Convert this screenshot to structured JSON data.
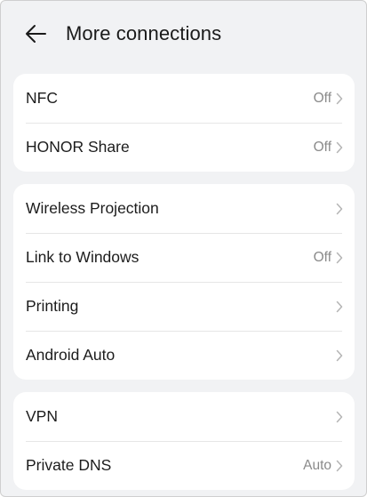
{
  "header": {
    "back_icon": "arrow-left-icon",
    "title": "More connections"
  },
  "groups": [
    {
      "items": [
        {
          "label": "NFC",
          "value": "Off"
        },
        {
          "label": "HONOR Share",
          "value": "Off"
        }
      ]
    },
    {
      "items": [
        {
          "label": "Wireless Projection",
          "value": ""
        },
        {
          "label": "Link to Windows",
          "value": "Off"
        },
        {
          "label": "Printing",
          "value": ""
        },
        {
          "label": "Android Auto",
          "value": ""
        }
      ]
    },
    {
      "items": [
        {
          "label": "VPN",
          "value": ""
        },
        {
          "label": "Private DNS",
          "value": "Auto"
        }
      ]
    }
  ],
  "colors": {
    "background": "#f1f2f4",
    "card": "#ffffff",
    "text": "#1c1c1c",
    "secondary_text": "#8a8a8a",
    "chevron": "#b5b5b5"
  }
}
